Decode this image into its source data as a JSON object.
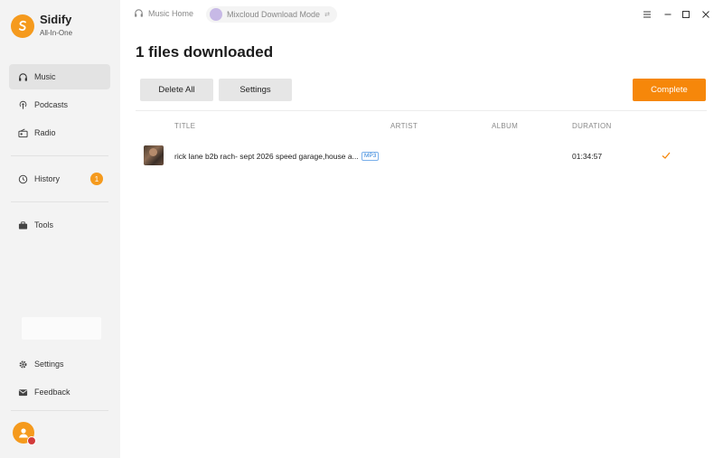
{
  "app": {
    "name": "Sidify",
    "subtitle": "All-In-One"
  },
  "sidebar": {
    "items": [
      {
        "label": "Music"
      },
      {
        "label": "Podcasts"
      },
      {
        "label": "Radio"
      },
      {
        "label": "History",
        "badge": "1"
      },
      {
        "label": "Tools"
      },
      {
        "label": "Settings"
      },
      {
        "label": "Feedback"
      }
    ]
  },
  "breadcrumb": {
    "home": "Music Home",
    "mode": "Mixcloud Download Mode"
  },
  "main": {
    "title": "1 files downloaded",
    "buttons": {
      "delete_all": "Delete All",
      "settings": "Settings",
      "complete": "Complete"
    },
    "columns": {
      "title": "TITLE",
      "artist": "ARTIST",
      "album": "ALBUM",
      "duration": "DURATION"
    },
    "rows": [
      {
        "title": "rick lane b2b rach- sept 2026 speed garage,house a...",
        "format": "MP3",
        "artist": "",
        "album": "",
        "duration": "01:34:57"
      }
    ]
  },
  "colors": {
    "accent": "#f6870a",
    "brand": "#f59a1d",
    "format_badge": "#2a7fd8"
  },
  "icons": [
    "headphones-icon",
    "podcast-icon",
    "radio-icon",
    "history-icon",
    "tools-icon",
    "settings-icon",
    "feedback-icon",
    "menu-icon",
    "minimize-icon",
    "maximize-icon",
    "close-icon",
    "check-icon"
  ]
}
